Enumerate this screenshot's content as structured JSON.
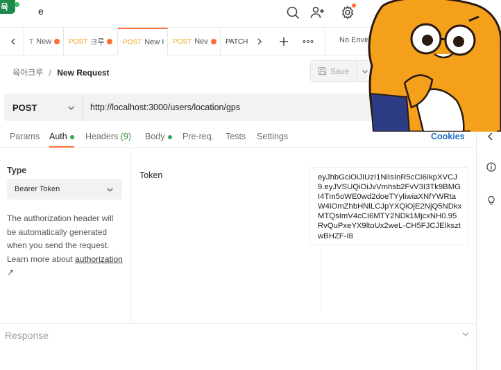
{
  "app": {
    "logo_text": "육자",
    "title": "e"
  },
  "tabs": [
    {
      "method": "T",
      "name": "New",
      "active": false
    },
    {
      "method": "POST",
      "name": "크루",
      "active": false
    },
    {
      "method": "POST",
      "name": "New I",
      "active": true
    },
    {
      "method": "POST",
      "name": "Nev",
      "active": false
    },
    {
      "method": "PATCH",
      "name": "",
      "active": false
    }
  ],
  "environment": {
    "label": "No Enviro"
  },
  "breadcrumb": {
    "parent": "육아크루",
    "separator": "/",
    "current": "New Request"
  },
  "save": {
    "label": "Save"
  },
  "request": {
    "method": "POST",
    "url": "http://localhost:3000/users/location/gps"
  },
  "request_tabs": {
    "params": "Params",
    "auth": "Auth",
    "headers": "Headers",
    "headers_count": "(9)",
    "body": "Body",
    "prereq": "Pre-req.",
    "tests": "Tests",
    "settings": "Settings",
    "cookies": "Cookies"
  },
  "auth": {
    "type_label": "Type",
    "type_value": "Bearer Token",
    "help_text": "The authorization header will be automatically generated when you send the request. Learn more about",
    "help_link": "authorization",
    "help_link_arrow": "↗",
    "token_label": "Token",
    "token_value": "eyJhbGciOiJIUzI1NiIsInR5cCI6IkpXVCJ9.eyJVSUQiOiJvVmhsb2FvV3I3Tk9BMGI4Tm5oWE0wd2doeTYyliwiaXNfYWRtaW4iOmZhbHNlLCJpYXQiOjE2NjQ5NDkxMTQsImV4cCI6MTY2NDk1MjcxNH0.95RvQuPxeYX9ltoUx2weL-CH5FJCJEIksztwBHZF-I8"
  },
  "response": {
    "title": "Response"
  },
  "colors": {
    "accent": "#ff6c37",
    "success": "#3aa55d",
    "link": "#1a6fc4",
    "method_post": "#f0a31d"
  }
}
